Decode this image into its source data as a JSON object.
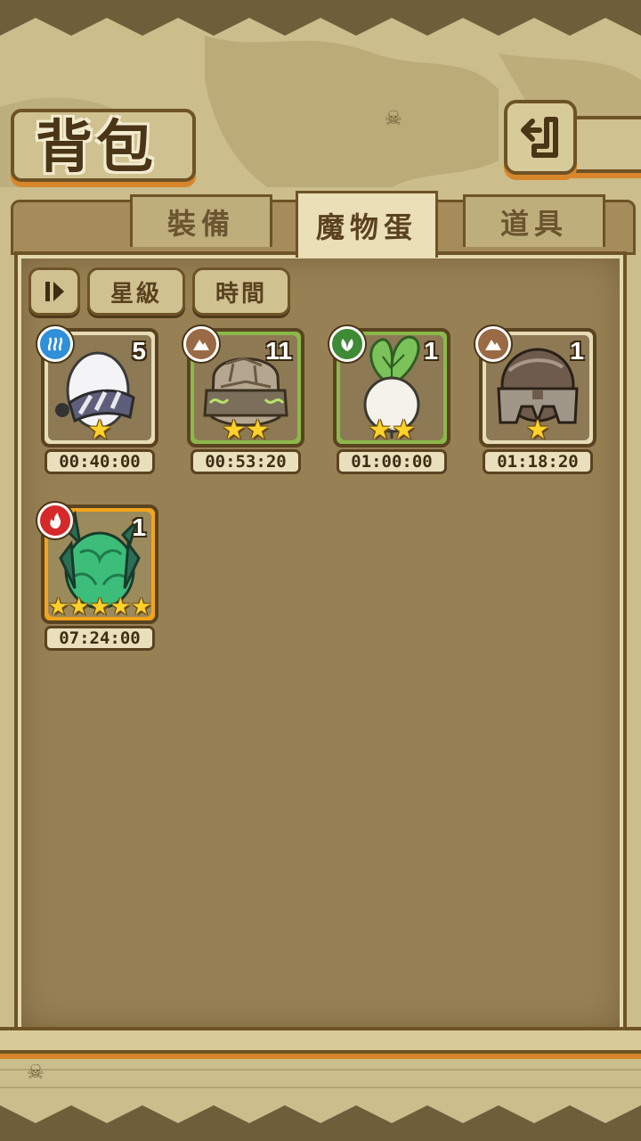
{
  "header": {
    "title": "背包",
    "back_icon": "return-arrow-icon"
  },
  "tabs": [
    {
      "label": "裝備",
      "active": false
    },
    {
      "label": "魔物蛋",
      "active": true
    },
    {
      "label": "道具",
      "active": false
    }
  ],
  "sort": {
    "toggle_icon": "sort-toggle-icon",
    "by_star": "星級",
    "by_time": "時間"
  },
  "eggs": [
    {
      "element": "water",
      "count": "5",
      "rarity": 1,
      "stars": "★",
      "timer": "00:40:00"
    },
    {
      "element": "earth",
      "count": "11",
      "rarity": 2,
      "stars": "★★",
      "timer": "00:53:20"
    },
    {
      "element": "wood",
      "count": "1",
      "rarity": 2,
      "stars": "★★",
      "timer": "01:00:00"
    },
    {
      "element": "earth",
      "count": "1",
      "rarity": 1,
      "stars": "★",
      "timer": "01:18:20"
    },
    {
      "element": "fire",
      "count": "1",
      "rarity": 5,
      "stars": "★★★★★",
      "timer": "07:24:00"
    }
  ],
  "colors": {
    "water": "#2f8fd8",
    "earth": "#9a6a45",
    "wood": "#3f8a35",
    "fire": "#d62a2a",
    "accent_orange": "#d8862b",
    "frame_brown": "#6e5326"
  }
}
